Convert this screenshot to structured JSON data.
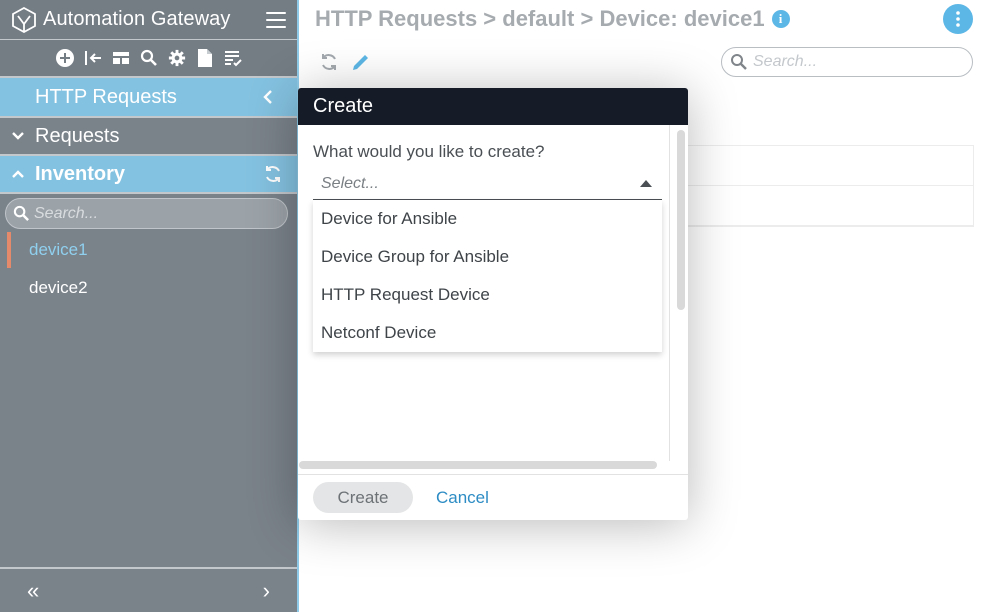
{
  "app": {
    "title": "Automation Gateway"
  },
  "sidebar": {
    "section_title": "HTTP Requests",
    "requests_label": "Requests",
    "inventory_label": "Inventory",
    "search_placeholder": "Search...",
    "devices": [
      {
        "name": "device1",
        "active": true
      },
      {
        "name": "device2",
        "active": false
      }
    ],
    "footer": {
      "collapse": "«",
      "next": "›"
    },
    "toolbar_icons": [
      "add-icon",
      "import-icon",
      "layout-icon",
      "search-icon",
      "gear-icon",
      "file-icon",
      "checklist-icon"
    ]
  },
  "main": {
    "breadcrumb": "HTTP Requests > default > Device: device1",
    "info_glyph": "i",
    "search_placeholder": "Search..."
  },
  "modal": {
    "title": "Create",
    "prompt": "What would you like to create?",
    "select_placeholder": "Select...",
    "options": [
      "Device for Ansible",
      "Device Group for Ansible",
      "HTTP Request Device",
      "Netconf Device"
    ],
    "create_label": "Create",
    "cancel_label": "Cancel"
  },
  "colors": {
    "sidebar_bg": "#7a828a",
    "accent_blue": "#84c2e1",
    "modal_header": "#151b27",
    "active_marker": "#e68a6c",
    "link_blue": "#2d8cc4"
  }
}
